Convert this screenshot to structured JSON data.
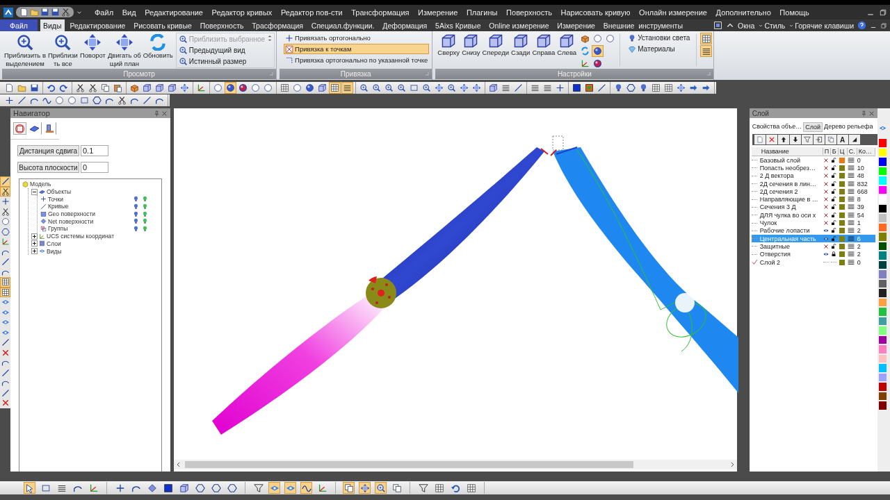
{
  "menu": [
    "Файл",
    "Вид",
    "Редактирование",
    "Редактор кривых",
    "Редактор пов-сти",
    "Трансформация",
    "Измерение",
    "Плагины",
    "Поверхность",
    "Нарисовать кривую",
    "Онлайн измерение",
    "Дополнительно",
    "Помощь"
  ],
  "quick_access": [
    {
      "kind": "page"
    },
    {
      "kind": "folder"
    },
    {
      "kind": "disk"
    },
    {
      "kind": "disk"
    },
    {
      "kind": "cut"
    }
  ],
  "tabs": [
    {
      "label": "Файл",
      "kind": "file",
      "selected": false
    },
    {
      "label": "Виды",
      "kind": "tab",
      "selected": true
    },
    {
      "label": "Редактирование",
      "kind": "tab",
      "selected": false
    },
    {
      "label": "Рисовать кривые",
      "kind": "tab",
      "selected": false
    },
    {
      "label": "Поверхность",
      "kind": "tab",
      "selected": false
    },
    {
      "label": "Трасформация",
      "kind": "tab",
      "selected": false
    },
    {
      "label": "Специал.функции.",
      "kind": "tab",
      "selected": false
    },
    {
      "label": "Деформация",
      "kind": "tab",
      "selected": false
    },
    {
      "label": "5Aixs Кривые",
      "kind": "tab",
      "selected": false
    },
    {
      "label": "Online измерение",
      "kind": "tab",
      "selected": false
    },
    {
      "label": "Измерение",
      "kind": "tab",
      "selected": false
    },
    {
      "label": "Внешние  инструменты",
      "kind": "tab",
      "selected": false
    }
  ],
  "tab_tools": [
    "Окна",
    "Стиль",
    "Горячие клавиши"
  ],
  "ribbon": [
    {
      "kind": "view",
      "title": "Просмотр",
      "large": [
        {
          "kind": "zoom",
          "label": "Приблизить в\nвыделением"
        },
        {
          "kind": "zoom",
          "label": "Приблизи\nть все"
        },
        {
          "kind": "move",
          "label": "Поворот"
        },
        {
          "kind": "move",
          "label": "Двигать об\nщий план"
        },
        {
          "kind": "refresh",
          "label": "Обновить"
        }
      ],
      "small": [
        {
          "kind": "zoom",
          "label": "Приблизить выбранное",
          "disabled": true
        },
        {
          "kind": "zoom",
          "label": "Предыдущий вид",
          "disabled": false
        },
        {
          "kind": "zoom",
          "label": "Истинный размер",
          "disabled": false
        }
      ]
    },
    {
      "kind": "snap",
      "title": "Привязка",
      "small": [
        {
          "kind": "point",
          "label": "Привязать ортогонально",
          "on": false
        },
        {
          "kind": "cross",
          "label": "Привязка к точкам",
          "on": true
        },
        {
          "kind": "corner",
          "label": "Привязка ортогонально по указанной точке",
          "on": false
        }
      ]
    },
    {
      "kind": "settings",
      "title": "Настройки",
      "large": [
        {
          "kind": "cube",
          "label": "Сверху"
        },
        {
          "kind": "cube",
          "label": "Снизу"
        },
        {
          "kind": "cube",
          "label": "Спереди"
        },
        {
          "kind": "cube",
          "label": "Сзади"
        },
        {
          "kind": "cube",
          "label": "Справа"
        },
        {
          "kind": "cube",
          "label": "Слева"
        }
      ],
      "icons": [
        {
          "kind": "box",
          "on": false
        },
        {
          "kind": "refresh",
          "on": false
        },
        {
          "kind": "axes",
          "on": false
        },
        {
          "kind": "circle",
          "on": false
        },
        {
          "kind": "sphere",
          "on": true
        },
        {
          "kind": "redsphere",
          "on": false
        },
        {
          "kind": "circle",
          "on": false
        }
      ],
      "small": [
        {
          "kind": "bulb",
          "label": "Установки света"
        },
        {
          "kind": "gem",
          "label": "Материалы"
        }
      ],
      "extra": [
        {
          "kind": "grid",
          "on": true
        },
        {
          "kind": "lines",
          "on": true
        }
      ]
    }
  ],
  "toolbars": {
    "top": [
      [
        {
          "kind": "page",
          "on": false
        },
        {
          "kind": "folder",
          "on": false
        },
        {
          "kind": "disk",
          "on": false
        }
      ],
      [
        {
          "kind": "undo",
          "on": false
        },
        {
          "kind": "redo",
          "on": false
        }
      ],
      [
        {
          "kind": "cut",
          "on": false
        },
        {
          "kind": "cut",
          "on": false
        },
        {
          "kind": "copy",
          "on": false
        },
        {
          "kind": "paste",
          "on": false
        }
      ],
      [
        {
          "kind": "box",
          "on": false
        },
        {
          "kind": "cube",
          "on": false
        },
        {
          "kind": "cube",
          "on": false
        },
        {
          "kind": "cube",
          "on": false
        },
        {
          "kind": "move",
          "on": false
        }
      ],
      [
        {
          "kind": "axes",
          "on": false
        }
      ],
      [
        {
          "kind": "circle",
          "on": false
        },
        {
          "kind": "sphere",
          "on": true
        },
        {
          "kind": "redsphere",
          "on": false
        },
        {
          "kind": "circle",
          "on": false
        },
        {
          "kind": "circle",
          "on": false
        }
      ],
      [
        {
          "kind": "grid",
          "on": false
        },
        {
          "kind": "circle",
          "on": false
        },
        {
          "kind": "sphere",
          "on": false
        },
        {
          "kind": "cube",
          "on": false
        },
        {
          "kind": "grid",
          "on": true
        },
        {
          "kind": "lines",
          "on": true
        }
      ],
      [
        {
          "kind": "zoom",
          "on": false
        },
        {
          "kind": "zoom",
          "on": false
        },
        {
          "kind": "zoom",
          "on": false
        },
        {
          "kind": "zoom",
          "on": false
        },
        {
          "kind": "square",
          "on": false
        },
        {
          "kind": "zoom",
          "on": false
        },
        {
          "kind": "move",
          "on": false
        },
        {
          "kind": "zoom",
          "on": false
        },
        {
          "kind": "move",
          "on": false
        },
        {
          "kind": "move",
          "on": false
        }
      ],
      [
        {
          "kind": "cube",
          "on": false
        },
        {
          "kind": "lines",
          "on": false
        },
        {
          "kind": "line",
          "on": false
        }
      ],
      [
        {
          "kind": "lines",
          "on": false
        },
        {
          "kind": "lines",
          "on": false
        },
        {
          "kind": "point",
          "on": false
        }
      ],
      [
        {
          "kind": "color",
          "on": false
        },
        {
          "kind": "gradient",
          "on": false
        },
        {
          "kind": "line",
          "on": false
        }
      ],
      [
        {
          "kind": "bulb",
          "on": false
        },
        {
          "kind": "polygon",
          "on": false
        },
        {
          "kind": "bulb",
          "on": false
        },
        {
          "kind": "grid",
          "on": false
        },
        {
          "kind": "grid",
          "on": false
        },
        {
          "kind": "move",
          "on": false
        },
        {
          "kind": "arrow",
          "on": false
        },
        {
          "kind": "arrow",
          "on": false
        }
      ]
    ],
    "draw": [
      [
        {
          "kind": "point",
          "on": false
        },
        {
          "kind": "line",
          "on": false
        },
        {
          "kind": "arc",
          "on": false
        },
        {
          "kind": "wave",
          "on": false
        },
        {
          "kind": "circle",
          "on": false
        },
        {
          "kind": "circle",
          "on": false
        },
        {
          "kind": "square",
          "on": false
        },
        {
          "kind": "polygon",
          "on": false
        },
        {
          "kind": "arc",
          "on": false
        },
        {
          "kind": "cut",
          "on": false
        },
        {
          "kind": "arc",
          "on": false
        },
        {
          "kind": "line",
          "on": false
        },
        {
          "kind": "arc",
          "on": false
        }
      ]
    ],
    "side": [
      {
        "kind": "line",
        "on": true
      },
      {
        "kind": "cut",
        "on": true
      },
      {
        "kind": "point",
        "on": false
      },
      {
        "kind": "cut",
        "on": false
      },
      {
        "kind": "circle",
        "on": false
      },
      {
        "kind": "polygon",
        "on": false
      },
      {
        "kind": "axes",
        "on": false
      },
      {
        "kind": "arc",
        "on": false
      },
      {
        "kind": "line",
        "on": false
      },
      {
        "kind": "arc",
        "on": false
      },
      {
        "kind": "grid",
        "on": true
      },
      {
        "kind": "grid",
        "on": true
      },
      {
        "kind": "views",
        "on": false
      },
      {
        "kind": "views",
        "on": false
      },
      {
        "kind": "views",
        "on": false
      },
      {
        "kind": "views",
        "on": false
      },
      {
        "kind": "line",
        "on": false
      },
      {
        "kind": "x",
        "on": false
      },
      {
        "kind": "arc",
        "on": false
      },
      {
        "kind": "line",
        "on": false
      },
      {
        "kind": "arc",
        "on": false
      },
      {
        "kind": "line",
        "on": false
      },
      {
        "kind": "x",
        "on": false
      }
    ],
    "bottom": [
      [
        {
          "kind": "cursor",
          "on": true
        },
        {
          "kind": "square",
          "on": false
        },
        {
          "kind": "lines",
          "on": false
        },
        {
          "kind": "arc",
          "on": false
        },
        {
          "kind": "axes",
          "on": false
        }
      ],
      [
        {
          "kind": "point",
          "on": false
        },
        {
          "kind": "arc",
          "on": false
        },
        {
          "kind": "net",
          "on": false
        },
        {
          "kind": "color",
          "on": false
        },
        {
          "kind": "cube",
          "on": false
        },
        {
          "kind": "polygon",
          "on": false
        },
        {
          "kind": "polygon",
          "on": false
        },
        {
          "kind": "polygon",
          "on": false
        }
      ],
      [
        {
          "kind": "filter",
          "on": false
        },
        {
          "kind": "views",
          "on": true
        },
        {
          "kind": "views",
          "on": true
        },
        {
          "kind": "wave",
          "on": true
        },
        {
          "kind": "axes",
          "on": false
        }
      ],
      [
        {
          "kind": "copy",
          "on": true
        },
        {
          "kind": "move",
          "on": true
        },
        {
          "kind": "zoom",
          "on": true
        },
        {
          "kind": "copy",
          "on": false
        }
      ],
      [
        {
          "kind": "filter",
          "on": false
        },
        {
          "kind": "grid",
          "on": false
        },
        {
          "kind": "undo",
          "on": false
        },
        {
          "kind": "grid",
          "on": false
        }
      ]
    ]
  },
  "navigator": {
    "title": "Навигатор",
    "tabs": [
      {
        "kind": "frame",
        "selected": true
      },
      {
        "kind": "plane",
        "selected": false
      },
      {
        "kind": "tool",
        "selected": false
      }
    ],
    "fields": [
      {
        "label": "Дистанция сдвига",
        "value": "0.1"
      },
      {
        "label": "Высота плоскости",
        "value": "0"
      }
    ],
    "tree": [
      {
        "label": "Модель",
        "kind": "model",
        "children": [
          {
            "label": "Объекты",
            "kind": "plane",
            "expanded": true,
            "children": [
              {
                "label": "Точки",
                "kind": "point"
              },
              {
                "label": "Кривые",
                "kind": "line"
              },
              {
                "label": "Geo поверхности",
                "kind": "geo"
              },
              {
                "label": "Net поверхности",
                "kind": "net"
              },
              {
                "label": "Группы",
                "kind": "group"
              }
            ]
          },
          {
            "label": "UCS системы координат",
            "kind": "axes",
            "expanded": false
          },
          {
            "label": "Слои",
            "kind": "layers",
            "expanded": false
          },
          {
            "label": "Виды",
            "kind": "views",
            "expanded": false
          }
        ]
      }
    ]
  },
  "layers": {
    "title": "Слой",
    "tabs": [
      {
        "label": "Свойства объе…",
        "selected": false
      },
      {
        "label": "Слой",
        "selected": true
      },
      {
        "label": "Дерево рельефа",
        "selected": false
      }
    ],
    "tools": [
      {
        "kind": "page"
      },
      {
        "kind": "x"
      },
      {
        "kind": "up"
      },
      {
        "kind": "down"
      },
      {
        "kind": "filter"
      },
      {
        "kind": "import"
      },
      {
        "kind": "copy"
      },
      {
        "kind": "text",
        "label": "A"
      },
      {
        "kind": "triangle"
      }
    ],
    "columns": [
      "Название",
      "П",
      "Б",
      "Ц",
      "С.",
      "Ко…"
    ],
    "rows": [
      {
        "name": "Базовый слой",
        "kind": "layer",
        "visible": false,
        "locked": false,
        "color": "#f07a10",
        "count": "0",
        "selected": false
      },
      {
        "name": "Попасть необрез…",
        "kind": "layer",
        "visible": false,
        "locked": false,
        "color": "#7f7f10",
        "count": "10",
        "selected": false
      },
      {
        "name": "2 Д вектора",
        "kind": "layer",
        "visible": false,
        "locked": false,
        "color": "#7f7f10",
        "count": "48",
        "selected": false
      },
      {
        "name": "2Д сечения в лин…",
        "kind": "layer",
        "visible": false,
        "locked": false,
        "color": "#7f7f10",
        "count": "832",
        "selected": false
      },
      {
        "name": "2Д сечения 2",
        "kind": "layer",
        "visible": false,
        "locked": false,
        "color": "#7f7f10",
        "count": "668",
        "selected": false
      },
      {
        "name": "Направляющие в …",
        "kind": "layer",
        "visible": false,
        "locked": false,
        "color": "#7f7f10",
        "count": "8",
        "selected": false
      },
      {
        "name": "Сечения 3 Д",
        "kind": "layer",
        "visible": false,
        "locked": false,
        "color": "#7f7f10",
        "count": "39",
        "selected": false
      },
      {
        "name": "ДЛЯ чулка во оси x",
        "kind": "layer",
        "visible": false,
        "locked": false,
        "color": "#7f7f10",
        "count": "54",
        "selected": false
      },
      {
        "name": "Чулок",
        "kind": "layer",
        "visible": false,
        "locked": false,
        "color": "#7f7f10",
        "count": "1",
        "selected": false
      },
      {
        "name": "Рабочие лопасти",
        "kind": "layer",
        "visible": true,
        "locked": false,
        "color": "#7f7f10",
        "count": "2",
        "selected": false
      },
      {
        "name": "Центральная часть",
        "kind": "layer",
        "visible": true,
        "locked": false,
        "color": "#7f7f10",
        "count": "6",
        "selected": true
      },
      {
        "name": "Защитные",
        "kind": "layer",
        "visible": false,
        "locked": false,
        "color": "#7f7f10",
        "count": "2",
        "selected": false
      },
      {
        "name": "Отверстия",
        "kind": "layer",
        "visible": true,
        "locked": true,
        "color": "#7f7f10",
        "count": "2",
        "selected": false
      },
      {
        "name": "Слой 2",
        "kind": "current",
        "color": "#7f7f10",
        "count": "0",
        "selected": false
      }
    ]
  },
  "palette": [
    {
      "color": "#ff0000"
    },
    {
      "color": "#ffff00"
    },
    {
      "color": "#0000ff"
    },
    {
      "color": "#00ff00"
    },
    {
      "color": "#00ffff"
    },
    {
      "color": "#ff00ff"
    },
    {
      "color": "#ffffff"
    },
    {
      "color": "#000000"
    },
    {
      "color": "#c0c0c0"
    },
    {
      "color": "#ff6a20"
    },
    {
      "color": "#808000"
    },
    {
      "color": "#005000"
    },
    {
      "color": "#008080"
    },
    {
      "color": "#004040"
    },
    {
      "color": "#8080c0"
    },
    {
      "color": "#606060"
    },
    {
      "color": "#202020"
    },
    {
      "color": "#ffa040"
    },
    {
      "color": "#20c040"
    },
    {
      "color": "#40a0a0"
    },
    {
      "color": "#80ff80"
    },
    {
      "color": "#a000a0"
    },
    {
      "color": "#ff80c0"
    },
    {
      "color": "#ffc0c0"
    },
    {
      "color": "#00c0ff"
    },
    {
      "color": "#a0a0ff"
    },
    {
      "color": "#c00000"
    },
    {
      "color": "#804000"
    },
    {
      "color": "#800000"
    }
  ]
}
